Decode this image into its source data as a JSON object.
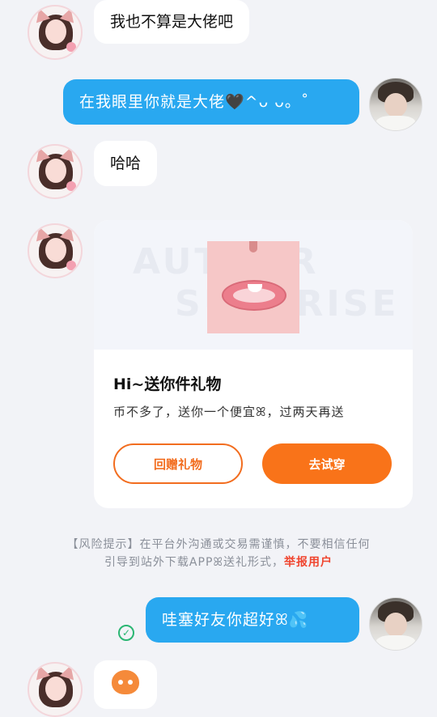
{
  "messages": [
    {
      "side": "left",
      "text": "我也不算是大佬吧"
    },
    {
      "side": "right",
      "text": "在我眼里你就是大佬🖤^ᴗ ᴗ。˚"
    },
    {
      "side": "left",
      "text": "哈哈"
    },
    {
      "side": "right",
      "text": "哇塞好友你超好ꕤ💦"
    }
  ],
  "gift_card": {
    "watermark_top": "AUTHOR",
    "watermark_bottom": "SURPRISE",
    "title": "Hi~送你件礼物",
    "description": "币不多了，送你一个便宜ꕤ，过两天再送",
    "return_gift_label": "回赠礼物",
    "try_on_label": "去试穿"
  },
  "notice": {
    "line1": "【风险提示】在平台外沟通或交易需谨慎，不要相信任何",
    "line2": "引导到站外下载APPꕤ送礼形式，",
    "report_link": "举报用户"
  },
  "status": {
    "sent_check": "✓"
  },
  "colors": {
    "accent_blue": "#29a8f0",
    "accent_orange": "#f97319",
    "report_red": "#f0452f",
    "check_green": "#2bb673"
  },
  "icons": {
    "avatar_other": "girl-avatar",
    "avatar_self": "boy-avatar",
    "sent_status": "check-circle-icon",
    "sticker": "orange-cat-sticker"
  }
}
